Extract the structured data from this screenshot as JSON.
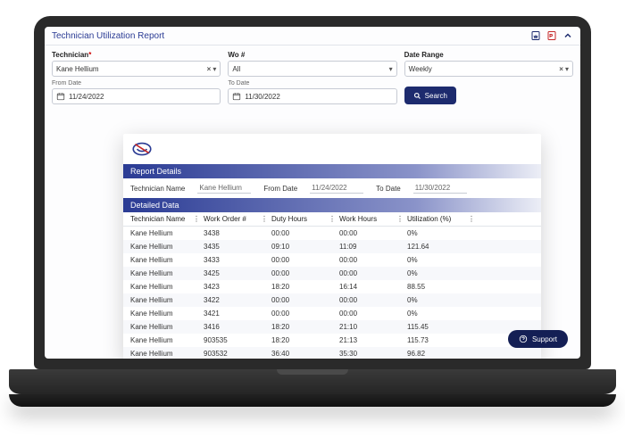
{
  "header": {
    "title": "Technician Utilization Report"
  },
  "filters": {
    "technician_label": "Technician",
    "technician_value": "Kane Hellium",
    "wo_label": "Wo #",
    "wo_value": "All",
    "date_range_label": "Date Range",
    "date_range_value": "Weekly",
    "from_date_label": "From Date",
    "from_date_value": "11/24/2022",
    "to_date_label": "To Date",
    "to_date_value": "11/30/2022",
    "search_label": "Search"
  },
  "report": {
    "details_title": "Report Details",
    "technician_name_label": "Technician Name",
    "technician_name_value": "Kane Hellium",
    "from_date_label": "From Date",
    "from_date_value": "11/24/2022",
    "to_date_label": "To Date",
    "to_date_value": "11/30/2022",
    "detailed_title": "Detailed Data",
    "columns": [
      "Technician Name",
      "Work Order #",
      "Duty Hours",
      "Work Hours",
      "Utilization (%)"
    ],
    "rows": [
      {
        "name": "Kane Hellium",
        "wo": "3438",
        "duty": "00:00",
        "work": "00:00",
        "util": "0%"
      },
      {
        "name": "Kane Hellium",
        "wo": "3435",
        "duty": "09:10",
        "work": "11:09",
        "util": "121.64"
      },
      {
        "name": "Kane Hellium",
        "wo": "3433",
        "duty": "00:00",
        "work": "00:00",
        "util": "0%"
      },
      {
        "name": "Kane Hellium",
        "wo": "3425",
        "duty": "00:00",
        "work": "00:00",
        "util": "0%"
      },
      {
        "name": "Kane Hellium",
        "wo": "3423",
        "duty": "18:20",
        "work": "16:14",
        "util": "88.55"
      },
      {
        "name": "Kane Hellium",
        "wo": "3422",
        "duty": "00:00",
        "work": "00:00",
        "util": "0%"
      },
      {
        "name": "Kane Hellium",
        "wo": "3421",
        "duty": "00:00",
        "work": "00:00",
        "util": "0%"
      },
      {
        "name": "Kane Hellium",
        "wo": "3416",
        "duty": "18:20",
        "work": "21:10",
        "util": "115.45"
      },
      {
        "name": "Kane Hellium",
        "wo": "903535",
        "duty": "18:20",
        "work": "21:13",
        "util": "115.73"
      },
      {
        "name": "Kane Hellium",
        "wo": "903532",
        "duty": "36:40",
        "work": "35:30",
        "util": "96.82"
      }
    ]
  },
  "support_label": "Support",
  "colors": {
    "primary": "#1d2b6e",
    "band_start": "#2a3b94"
  }
}
